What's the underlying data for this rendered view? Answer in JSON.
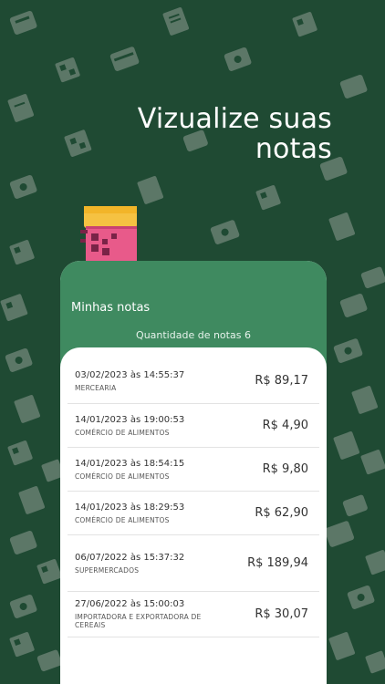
{
  "headline": {
    "line1": "Vizualize suas",
    "line2": "notas"
  },
  "app": {
    "screen_title": "Minhas notas",
    "count_label": "Quantidade de notas 6"
  },
  "notes": [
    {
      "date": "03/02/2023 às 14:55:37",
      "category": "MERCEARIA",
      "value": "R$ 89,17"
    },
    {
      "date": "14/01/2023 às 19:00:53",
      "category": "COMÉRCIO DE ALIMENTOS",
      "value": "R$ 4,90"
    },
    {
      "date": "14/01/2023 às 18:54:15",
      "category": "COMÉRCIO DE ALIMENTOS",
      "value": "R$ 9,80"
    },
    {
      "date": "14/01/2023 às 18:29:53",
      "category": "COMÉRCIO DE ALIMENTOS",
      "value": "R$ 62,90"
    },
    {
      "date": "06/07/2022 às 15:37:32",
      "category": "SUPERMERCADOS",
      "value": "R$ 189,94"
    },
    {
      "date": "27/06/2022 às 15:00:03",
      "category": "IMPORTADORA E EXPORTADORA DE CEREAIS",
      "value": "R$ 30,07"
    }
  ],
  "colors": {
    "background": "#1f4a33",
    "header": "#3f8a60",
    "icon_pattern": "#9aa89f"
  },
  "icons": [
    "receipt-icon",
    "qr-code-icon",
    "wallet-icon",
    "cash-icon",
    "clipboard-icon"
  ]
}
